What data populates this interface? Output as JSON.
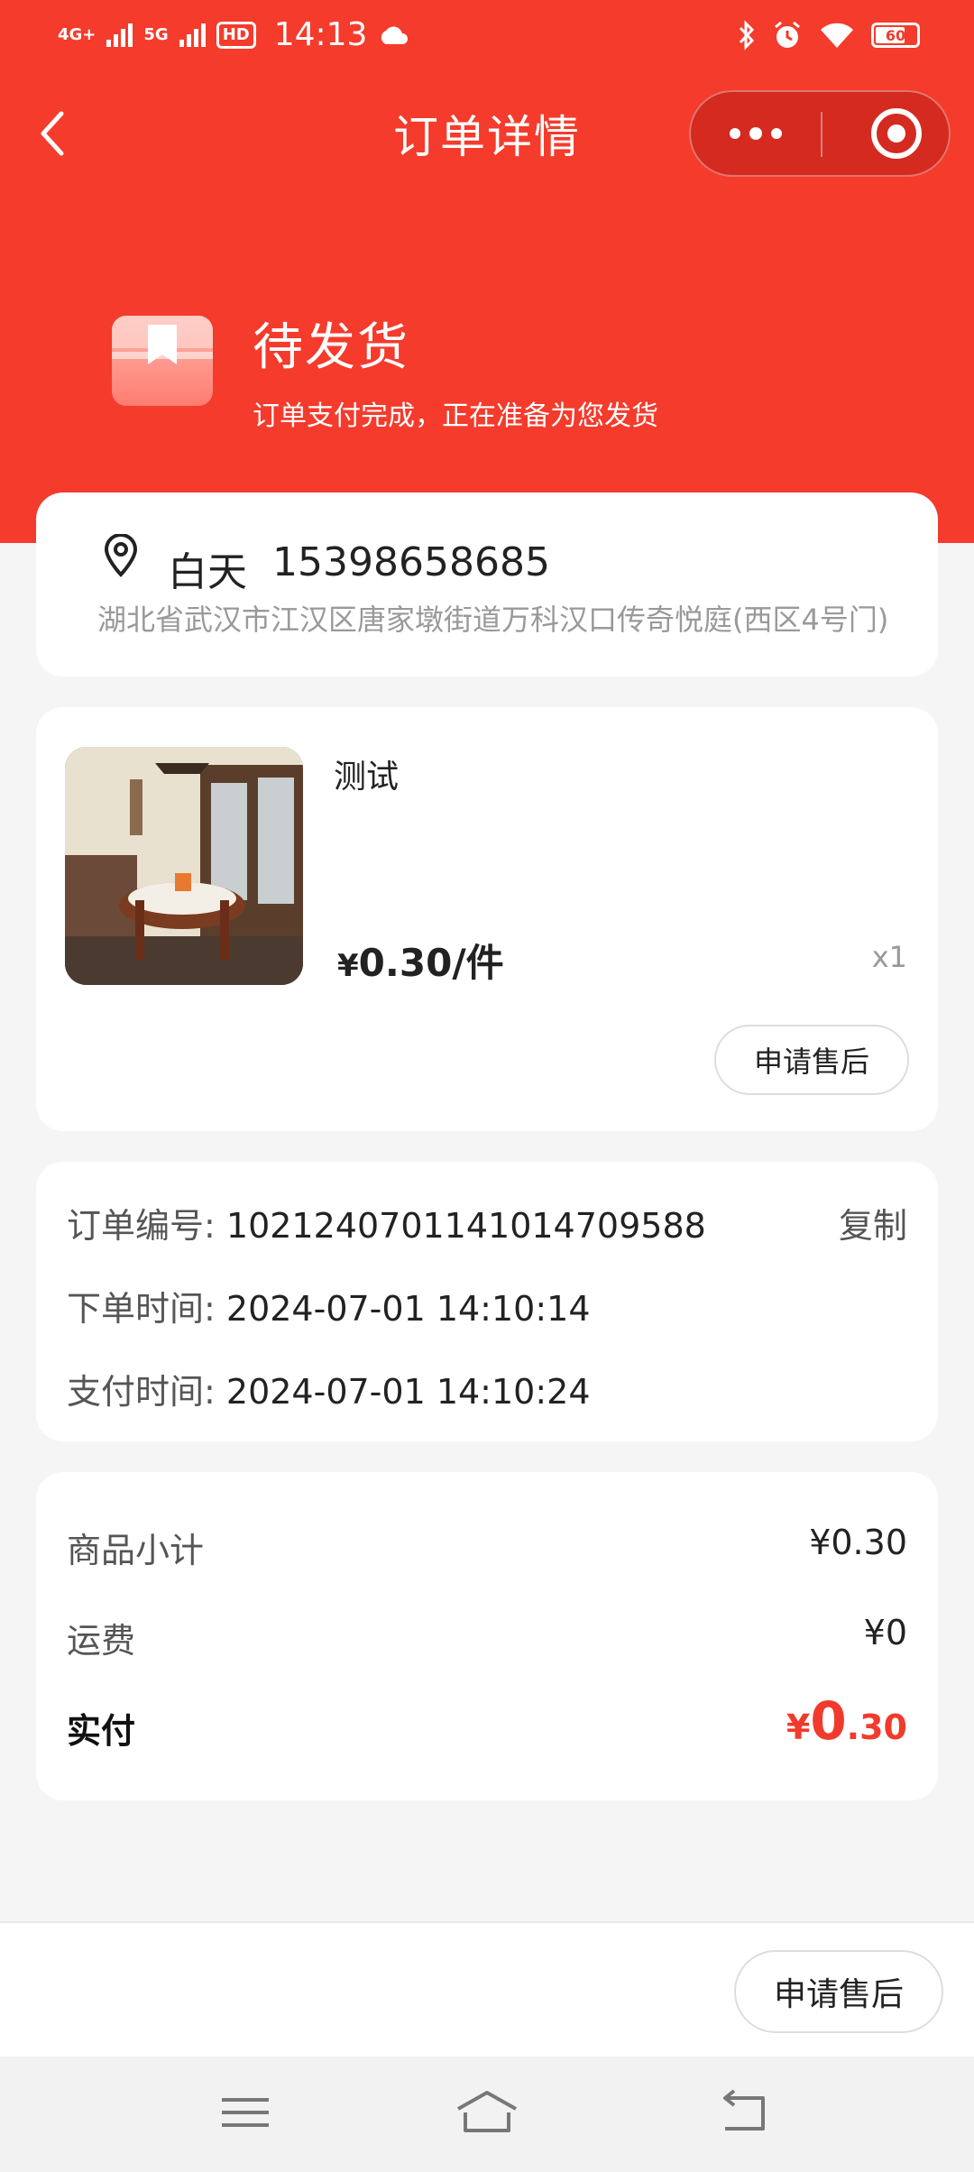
{
  "status_bar": {
    "network1": "4G+",
    "network2": "5G",
    "hd": "HD",
    "time": "14:13",
    "battery": "60"
  },
  "nav": {
    "title": "订单详情"
  },
  "order_status": {
    "title": "待发货",
    "description": "订单支付完成，正在准备为您发货"
  },
  "address": {
    "name": "白天",
    "phone": "15398658685",
    "detail": "湖北省武汉市江汉区唐家墩街道万科汉口传奇悦庭(西区4号门)"
  },
  "product": {
    "name": "测试",
    "price_currency": "¥",
    "price_value": "0.30",
    "price_unit": "/件",
    "quantity": "x1",
    "after_sale_label": "申请售后"
  },
  "order_info": {
    "order_no_label": "订单编号:",
    "order_no": "1021240701141014709588",
    "copy_label": "复制",
    "create_time_label": "下单时间:",
    "create_time": "2024-07-01 14:10:14",
    "pay_time_label": "支付时间:",
    "pay_time": "2024-07-01 14:10:24"
  },
  "costs": {
    "subtotal_label": "商品小计",
    "subtotal": "¥0.30",
    "shipping_label": "运费",
    "shipping": "¥0",
    "total_label": "实付",
    "total_currency": "¥",
    "total_int": "0",
    "total_dec": ".30"
  },
  "bottom_bar": {
    "after_sale_label": "申请售后"
  },
  "colors": {
    "brand_red": "#f43b2c",
    "price_red": "#f03b2c"
  }
}
